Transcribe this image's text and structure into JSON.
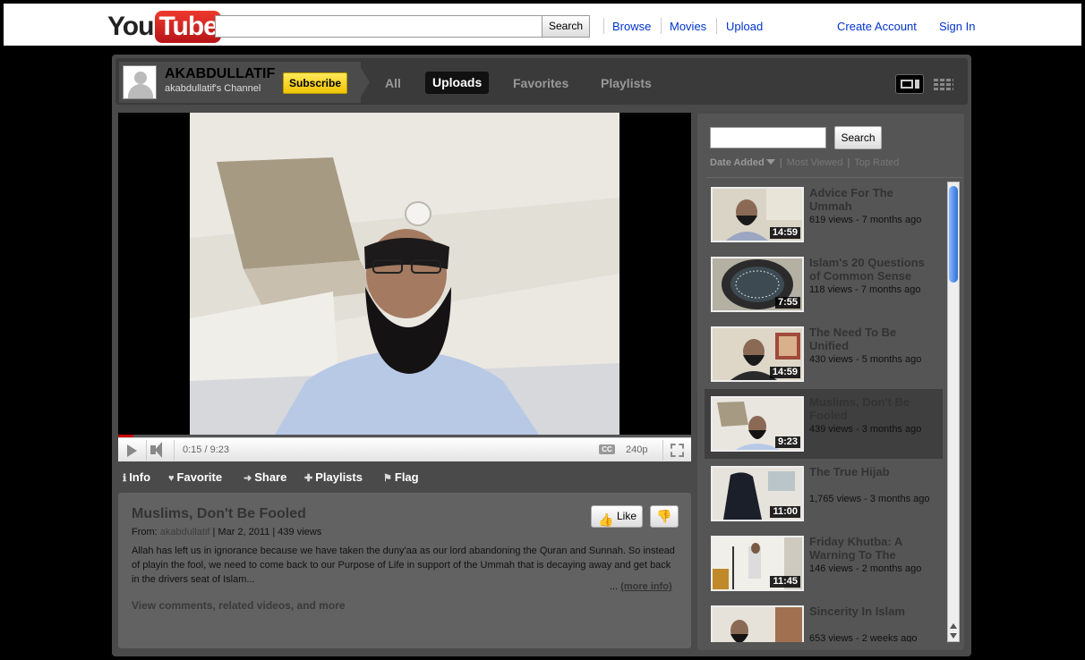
{
  "masthead": {
    "logo_you": "You",
    "logo_tube": "Tube",
    "search_button": "Search",
    "nav": [
      "Browse",
      "Movies",
      "Upload"
    ],
    "create_account": "Create Account",
    "sign_in": "Sign In"
  },
  "channel": {
    "name": "AKABDULLATIF",
    "subtitle": "akabdullatif's Channel",
    "subscribe": "Subscribe",
    "tabs": {
      "all": "All",
      "uploads": "Uploads",
      "favorites": "Favorites",
      "playlists": "Playlists"
    }
  },
  "player": {
    "time": "0:15 / 9:23",
    "cc": "CC",
    "quality": "240p",
    "progress": 0.027
  },
  "info_tabs": {
    "info": "Info",
    "favorite": "Favorite",
    "share": "Share",
    "playlists": "Playlists",
    "flag": "Flag"
  },
  "video": {
    "title": "Muslims, Don't Be Fooled",
    "from_label": "From:",
    "from_user": "akabdullatif",
    "meta_rest": "| Mar 2, 2011 | 439 views",
    "description": "Allah has left us in ignorance because we have taken the duny'aa as our lord abandoning the Quran and Sunnah. So instead of playin the fool, we need to come back to our Purpose of Life in support of the Ummah that is decaying away and get back in the drivers seat of Islam...",
    "more_prefix": "...",
    "more_info": "(more info)",
    "view_comments": "View comments, related videos, and more",
    "like": "Like"
  },
  "sidebar": {
    "search_button": "Search",
    "sort": {
      "date_added": "Date Added",
      "most_viewed": "Most Viewed",
      "top_rated": "Top Rated",
      "sep": "|"
    },
    "items": [
      {
        "title": "Advice For The Ummah",
        "meta": "619 views - 7 months ago",
        "duration": "14:59"
      },
      {
        "title": "Islam's 20 Questions of Common Sense",
        "meta": "118 views - 7 months ago",
        "duration": "7:55"
      },
      {
        "title": "The Need To Be Unified",
        "meta": "430 views - 5 months ago",
        "duration": "14:59"
      },
      {
        "title": "Muslims, Don't Be Fooled",
        "meta": "439 views - 3 months ago",
        "duration": "9:23"
      },
      {
        "title": "The True Hijab",
        "meta": "1,765 views - 3 months ago",
        "duration": "11:00"
      },
      {
        "title": "Friday Khutba: A Warning To The",
        "meta": "146 views - 2 months ago",
        "duration": "11:45"
      },
      {
        "title": "Sincerity In Islam",
        "meta": "653 views - 2 weeks ago",
        "duration": ""
      }
    ]
  }
}
